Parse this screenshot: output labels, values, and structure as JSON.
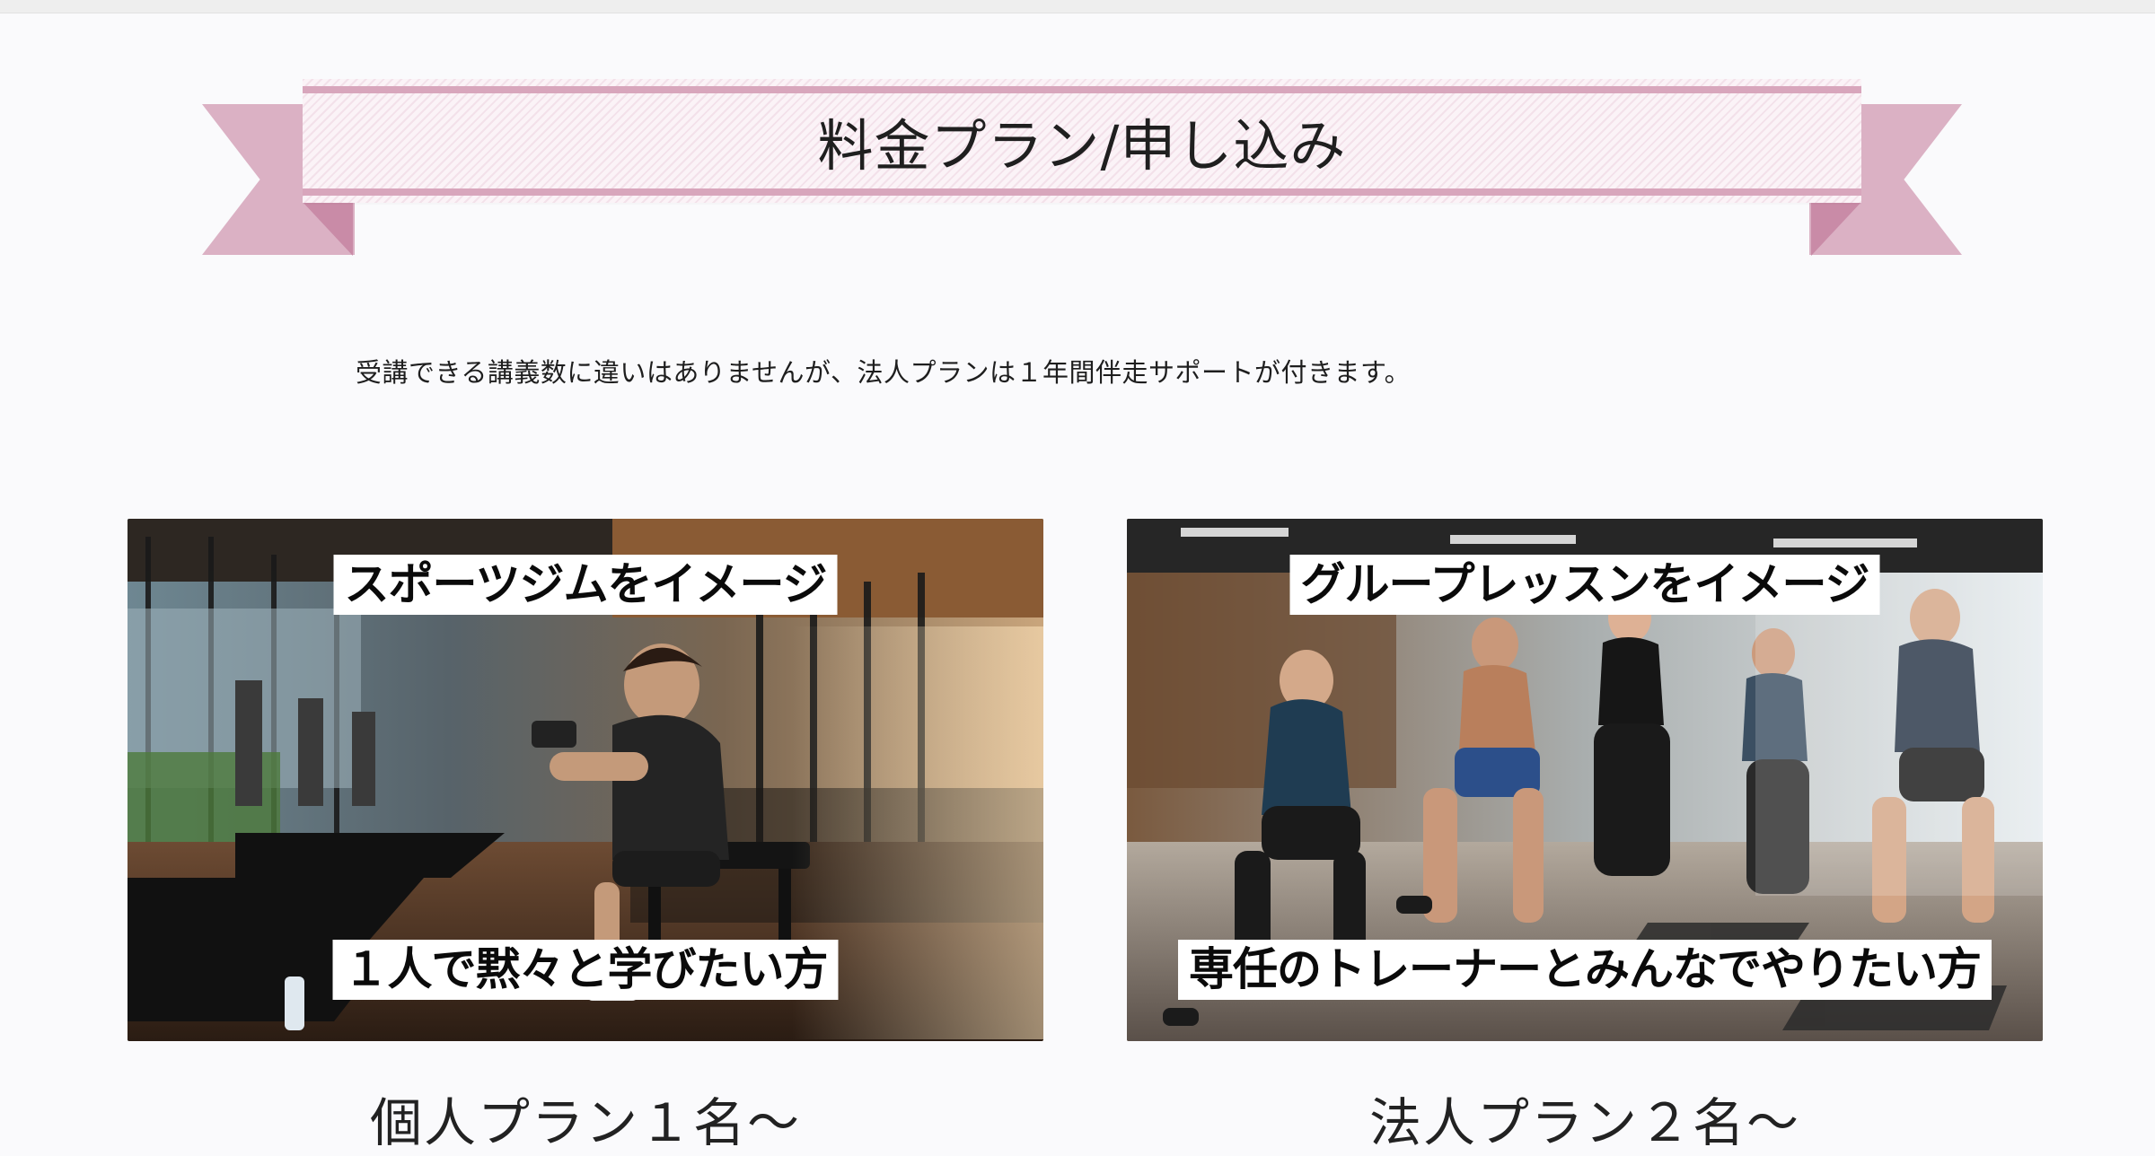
{
  "section": {
    "heading": "料金プラン/申し込み",
    "description": "受講できる講義数に違いはありませんが、法人プランは１年間伴走サポートが付きます。"
  },
  "plans": [
    {
      "top_caption": "スポーツジムをイメージ",
      "bottom_caption": "１人で黙々と学びたい方",
      "title": "個人プラン１名～"
    },
    {
      "top_caption": "グループレッスンをイメージ",
      "bottom_caption": "専任のトレーナーとみんなでやりたい方",
      "title": "法人プラン２名～"
    }
  ],
  "colors": {
    "ribbon": "#dbb1c4",
    "ribbon_fold": "#c98ba7",
    "ribbon_stripe": "#d8a6bc",
    "background": "#fafafc"
  }
}
